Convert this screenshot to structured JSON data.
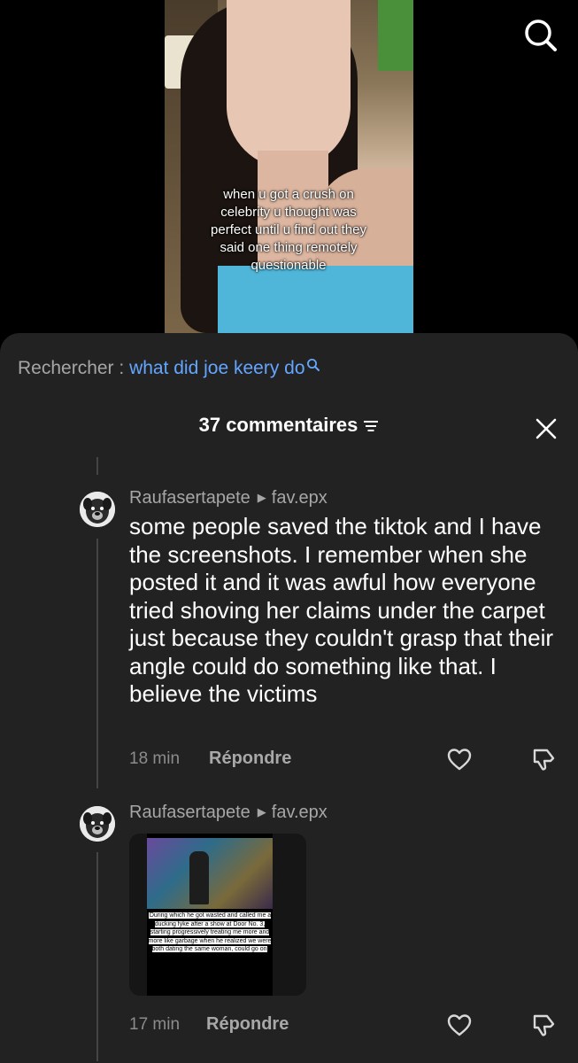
{
  "video": {
    "caption": "when u got a crush on celebrity u thought was perfect until u find out they said one thing remotely questionable"
  },
  "search_bar": {
    "label": "Rechercher : ",
    "query": "what did joe keery do"
  },
  "comments_header": {
    "title": "37 commentaires"
  },
  "comments": [
    {
      "username": "Raufasertapete",
      "reply_to": "fav.epx",
      "text": "some people saved the tiktok and I have the screenshots. I remember when she posted it and it was awful how everyone tried shoving her claims under the carpet just because they couldn't grasp that their angle could do something like that. I believe the victims",
      "time": "18 min",
      "reply_label": "Répondre"
    },
    {
      "username": "Raufasertapete",
      "reply_to": "fav.epx",
      "media_caption": "During which he got wasted and called me a ducking fyke after a show at Door No. 3, starting progressively treating me more and more like garbage when he realized we were both dating the same woman, could go on",
      "time": "17 min",
      "reply_label": "Répondre"
    }
  ],
  "colors": {
    "sheet_background": "#222222",
    "link_blue": "#64a6ff",
    "muted_text": "#a6a6a6"
  },
  "icons": [
    "search-icon",
    "filter-icon",
    "close-icon",
    "heart-icon",
    "dislike-icon",
    "chevron-right-icon"
  ]
}
